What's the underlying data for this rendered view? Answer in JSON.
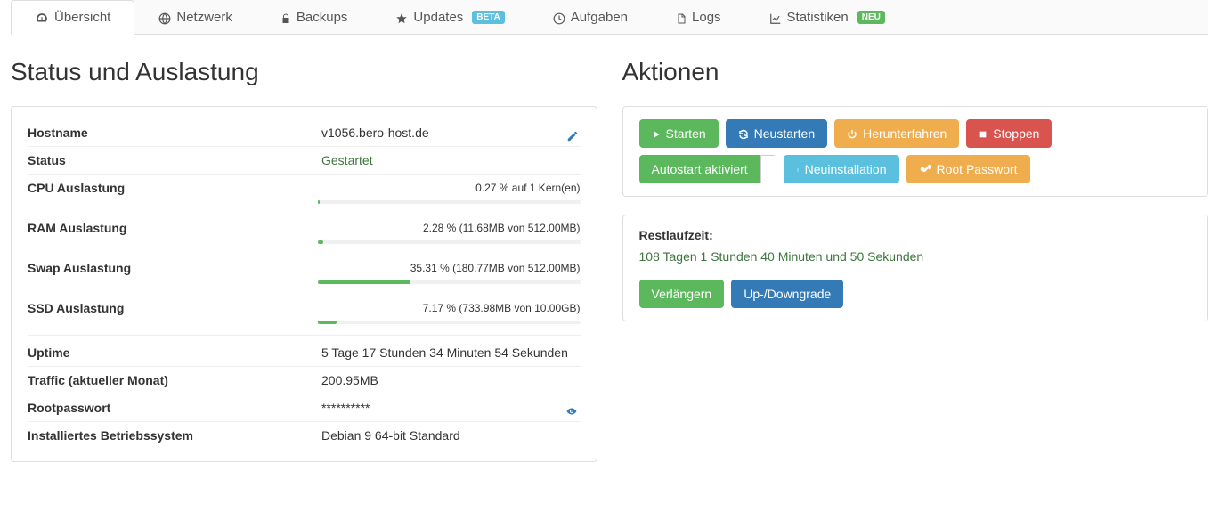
{
  "tabs": [
    {
      "label": "Übersicht",
      "icon": "dashboard",
      "active": true
    },
    {
      "label": "Netzwerk",
      "icon": "globe"
    },
    {
      "label": "Backups",
      "icon": "lock"
    },
    {
      "label": "Updates",
      "icon": "star",
      "badge": "BETA",
      "badge_type": "beta"
    },
    {
      "label": "Aufgaben",
      "icon": "clock"
    },
    {
      "label": "Logs",
      "icon": "file"
    },
    {
      "label": "Statistiken",
      "icon": "chart",
      "badge": "NEU",
      "badge_type": "new"
    }
  ],
  "left_heading": "Status und Auslastung",
  "right_heading": "Aktionen",
  "status": {
    "hostname_label": "Hostname",
    "hostname_value": "v1056.bero-host.de",
    "status_label": "Status",
    "status_value": "Gestartet",
    "cpu_label": "CPU Auslastung",
    "cpu_value": "0.27 % auf 1 Kern(en)",
    "cpu_pct": 0.27,
    "ram_label": "RAM Auslastung",
    "ram_value": "2.28 % (11.68MB von 512.00MB)",
    "ram_pct": 2.28,
    "swap_label": "Swap Auslastung",
    "swap_value": "35.31 % (180.77MB von 512.00MB)",
    "swap_pct": 35.31,
    "ssd_label": "SSD Auslastung",
    "ssd_value": "7.17 % (733.98MB von 10.00GB)",
    "ssd_pct": 7.17,
    "uptime_label": "Uptime",
    "uptime_value": "5 Tage 17 Stunden 34 Minuten 54 Sekunden",
    "traffic_label": "Traffic (aktueller Monat)",
    "traffic_value": "200.95MB",
    "rootpw_label": "Rootpasswort",
    "rootpw_value": "**********",
    "os_label": "Installiertes Betriebssystem",
    "os_value": "Debian 9 64-bit Standard"
  },
  "actions": {
    "start": "Starten",
    "restart": "Neustarten",
    "shutdown": "Herunterfahren",
    "stop": "Stoppen",
    "autostart": "Autostart aktiviert",
    "reinstall": "Neuinstallation",
    "rootpw": "Root Passwort"
  },
  "runtime": {
    "label": "Restlaufzeit:",
    "value": "108 Tagen 1 Stunden 40 Minuten und 50 Sekunden",
    "extend": "Verlängern",
    "updown": "Up-/Downgrade"
  }
}
